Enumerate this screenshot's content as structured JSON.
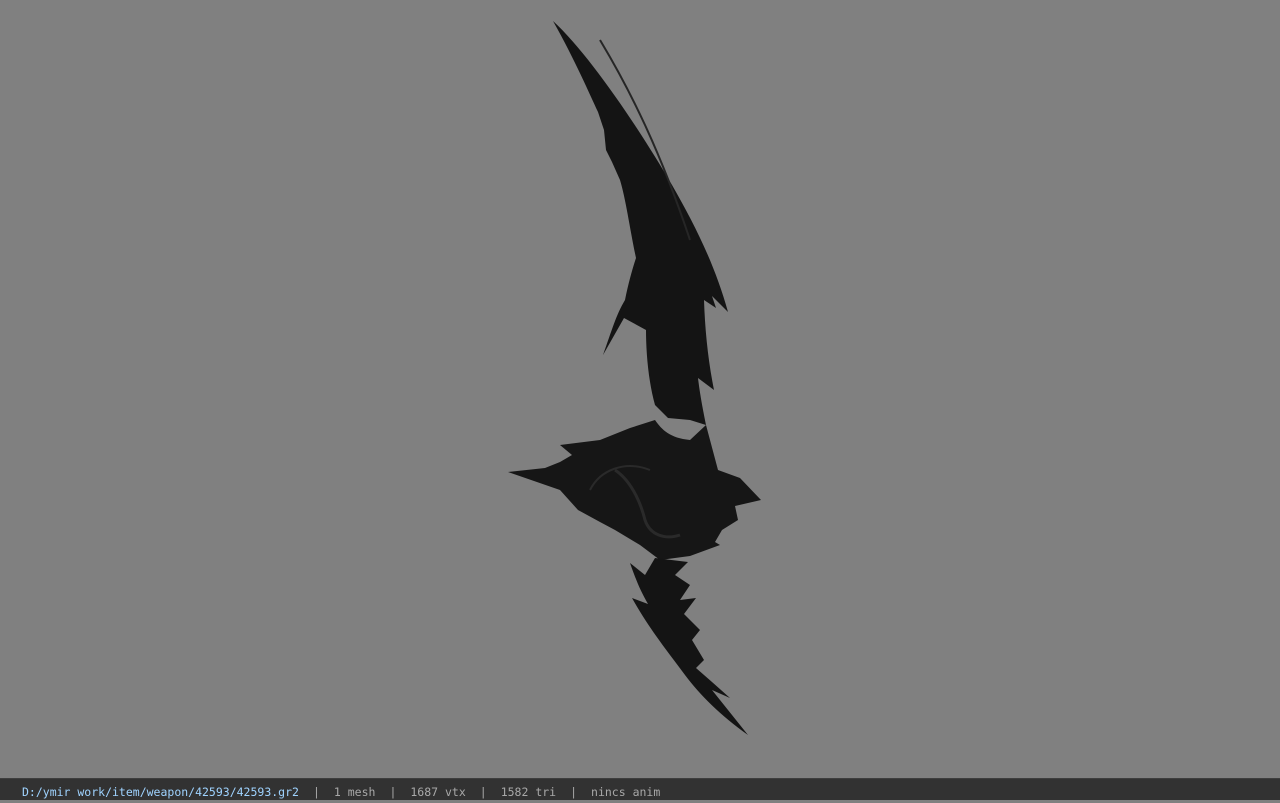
{
  "viewport": {
    "background_color": "#808080",
    "model": {
      "name": "dark-curved-blade-model",
      "color": "#141414"
    }
  },
  "statusbar": {
    "path": "D:/ymir work/item/weapon/42593/42593.gr2",
    "separator": "|",
    "mesh_count": "1 mesh",
    "vertex_count": "1687 vtx",
    "triangle_count": "1582 tri",
    "anim": "nincs anim",
    "path_color": "#9fd3ff",
    "text_color": "#a8a8a8"
  }
}
